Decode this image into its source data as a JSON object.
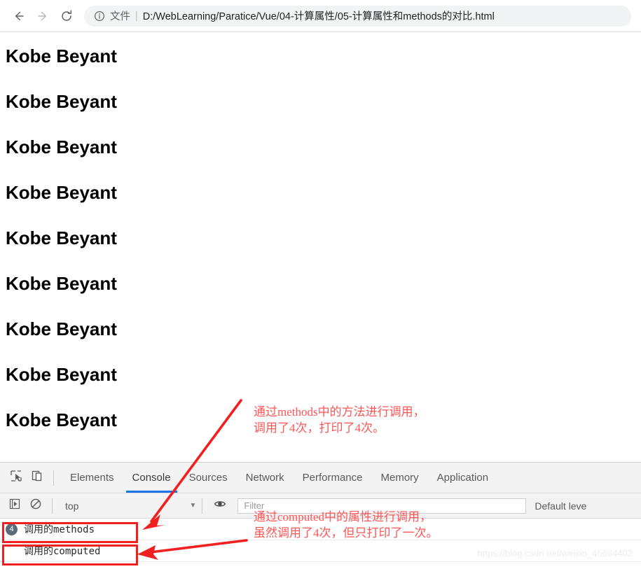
{
  "browser": {
    "back_icon": "arrow-left-icon",
    "forward_icon": "arrow-right-icon",
    "reload_icon": "reload-icon",
    "info_icon": "info-circle-icon",
    "omnibox": {
      "security_label": "文件",
      "separator": "|",
      "url": "D:/WebLearning/Paratice/Vue/04-计算属性/05-计算属性和methods的对比.html"
    }
  },
  "page": {
    "lines": [
      "Kobe Beyant",
      "Kobe Beyant",
      "Kobe Beyant",
      "Kobe Beyant",
      "Kobe Beyant",
      "Kobe Beyant",
      "Kobe Beyant",
      "Kobe Beyant",
      "Kobe Beyant"
    ]
  },
  "annotations": {
    "color": "#ff5555",
    "note_methods": "通过methods中的方法进行调用，\n调用了4次，打印了4次。",
    "note_computed": "通过computed中的属性进行调用，\n虽然调用了4次，但只打印了一次。"
  },
  "devtools": {
    "inspect_icon": "inspect-element-icon",
    "device_icon": "device-toolbar-icon",
    "tabs": [
      {
        "label": "Elements",
        "active": false
      },
      {
        "label": "Console",
        "active": true
      },
      {
        "label": "Sources",
        "active": false
      },
      {
        "label": "Network",
        "active": false
      },
      {
        "label": "Performance",
        "active": false
      },
      {
        "label": "Memory",
        "active": false
      },
      {
        "label": "Application",
        "active": false
      }
    ],
    "active_tab_color": "#1a73e8",
    "console_toolbar": {
      "execute_icon": "execute-arrow-icon",
      "clear_icon": "clear-console-icon",
      "context": "top",
      "caret_icon": "chevron-down-icon",
      "eye_icon": "eye-icon",
      "filter_placeholder": "Filter",
      "filter_value": "",
      "level": "Default leve"
    },
    "messages": [
      {
        "count": "4",
        "text": "调用的methods"
      },
      {
        "count": "",
        "text": "调用的computed"
      }
    ]
  },
  "watermark": "https://blog.csdn.net/weixin_45664402"
}
